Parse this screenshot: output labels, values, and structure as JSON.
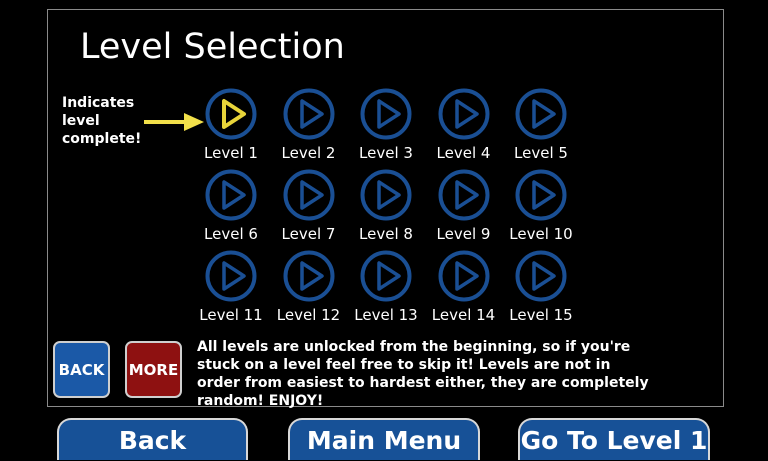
{
  "title": "Level Selection",
  "note": "Indicates level complete!",
  "levels": [
    {
      "label": "Level 1",
      "complete": true
    },
    {
      "label": "Level 2",
      "complete": false
    },
    {
      "label": "Level 3",
      "complete": false
    },
    {
      "label": "Level 4",
      "complete": false
    },
    {
      "label": "Level 5",
      "complete": false
    },
    {
      "label": "Level 6",
      "complete": false
    },
    {
      "label": "Level 7",
      "complete": false
    },
    {
      "label": "Level 8",
      "complete": false
    },
    {
      "label": "Level 9",
      "complete": false
    },
    {
      "label": "Level 10",
      "complete": false
    },
    {
      "label": "Level 11",
      "complete": false
    },
    {
      "label": "Level 12",
      "complete": false
    },
    {
      "label": "Level 13",
      "complete": false
    },
    {
      "label": "Level 14",
      "complete": false
    },
    {
      "label": "Level 15",
      "complete": false
    }
  ],
  "small_buttons": {
    "back": "BACK",
    "more": "MORE"
  },
  "info": "All levels are unlocked from the beginning, so if you're stuck on a level feel free to skip it! Levels are not in order from easiest to hardest either, they are completely random! ENJOY!",
  "bottom_buttons": {
    "back": "Back",
    "main_menu": "Main Menu",
    "go_to_level": "Go To Level 1"
  },
  "colors": {
    "incomplete_ring": "#1a4f94",
    "complete_ring": "#e8d43a",
    "back_button": "#1b59a7",
    "more_button": "#8e1111",
    "bottom_button": "#175197"
  },
  "icons": {
    "level_button": "play-icon",
    "pointer": "arrow-right-icon"
  }
}
